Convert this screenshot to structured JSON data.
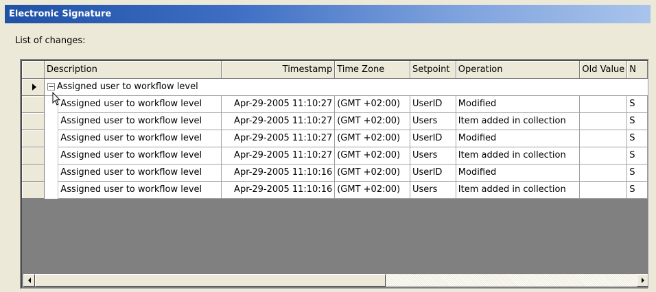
{
  "window": {
    "title": "Electronic Signature"
  },
  "caption": "List of changes:",
  "grid": {
    "columns": [
      "Description",
      "Timestamp",
      "Time Zone",
      "Setpoint",
      "Operation",
      "Old Value",
      "N"
    ],
    "group_label": "Assigned user to workflow level",
    "group_expander": "−",
    "rows": [
      [
        "Assigned user to workflow level",
        "Apr-29-2005 11:10:27",
        "(GMT +02:00)",
        "UserID",
        "Modified",
        "",
        "S"
      ],
      [
        "Assigned user to workflow level",
        "Apr-29-2005 11:10:27",
        "(GMT +02:00)",
        "Users",
        "Item added in collection",
        "",
        "S"
      ],
      [
        "Assigned user to workflow level",
        "Apr-29-2005 11:10:27",
        "(GMT +02:00)",
        "UserID",
        "Modified",
        "",
        "S"
      ],
      [
        "Assigned user to workflow level",
        "Apr-29-2005 11:10:27",
        "(GMT +02:00)",
        "Users",
        "Item added in collection",
        "",
        "S"
      ],
      [
        "Assigned user to workflow level",
        "Apr-29-2005 11:10:16",
        "(GMT +02:00)",
        "UserID",
        "Modified",
        "",
        "S"
      ],
      [
        "Assigned user to workflow level",
        "Apr-29-2005 11:10:16",
        "(GMT +02:00)",
        "Users",
        "Item added in collection",
        "",
        "S"
      ]
    ]
  },
  "icons": {
    "row_indicator": "current-row-arrow-icon",
    "scroll_left": "scroll-left-arrow-icon",
    "scroll_right": "scroll-right-arrow-icon",
    "cursor": "mouse-pointer-icon"
  },
  "colors": {
    "title_start": "#1f51a5",
    "title_end": "#a9c4ec",
    "window_bg": "#ece9d8",
    "empty_grid_bg": "#808080"
  }
}
